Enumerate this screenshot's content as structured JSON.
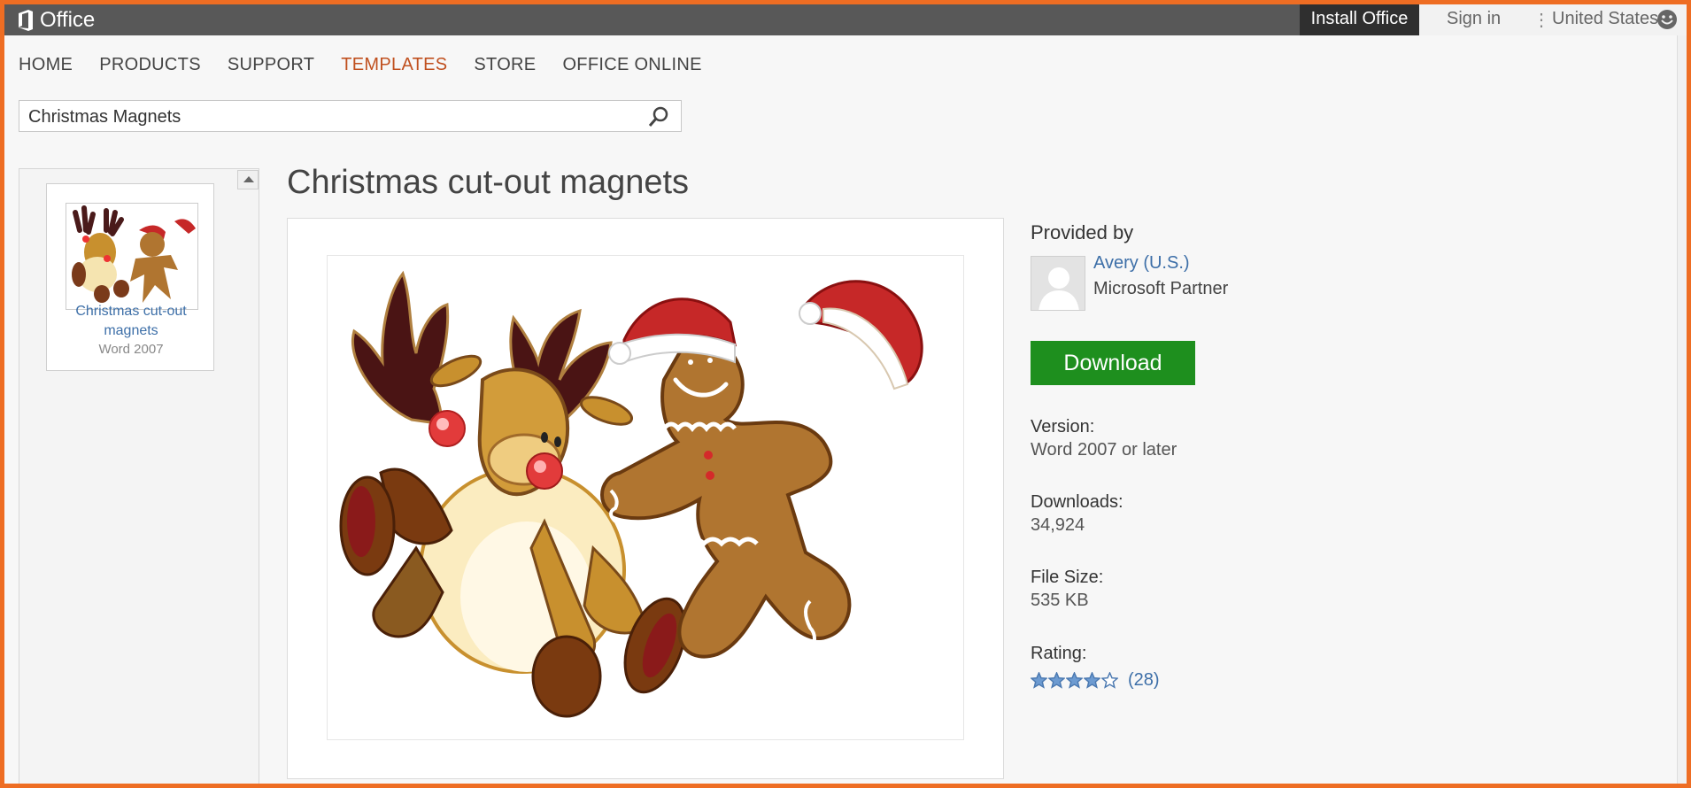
{
  "topbar": {
    "brand": "Office",
    "install_label": "Install Office",
    "signin_label": "Sign in",
    "separator": "⋮",
    "country_label": "United States"
  },
  "nav": {
    "items": [
      "HOME",
      "PRODUCTS",
      "SUPPORT",
      "TEMPLATES",
      "STORE",
      "OFFICE ONLINE"
    ],
    "active": "TEMPLATES"
  },
  "search": {
    "value": "Christmas Magnets"
  },
  "sidebar": {
    "card_title": "Christmas cut-out magnets",
    "card_version": "Word 2007"
  },
  "main": {
    "title": "Christmas cut-out magnets"
  },
  "details": {
    "provided_by_label": "Provided by",
    "provider_name": "Avery (U.S.)",
    "provider_role": "Microsoft Partner",
    "download_label": "Download",
    "version_label": "Version:",
    "version_value": "Word 2007 or later",
    "downloads_label": "Downloads:",
    "downloads_value": "34,924",
    "filesize_label": "File Size:",
    "filesize_value": "535 KB",
    "rating_label": "Rating:",
    "rating_stars": 4,
    "rating_count": "(28)"
  },
  "colors": {
    "frame": "#ee6d23",
    "topbar": "#585858",
    "nav_active": "#c0501f",
    "link": "#3d6fa8",
    "download": "#1e8f1e"
  }
}
